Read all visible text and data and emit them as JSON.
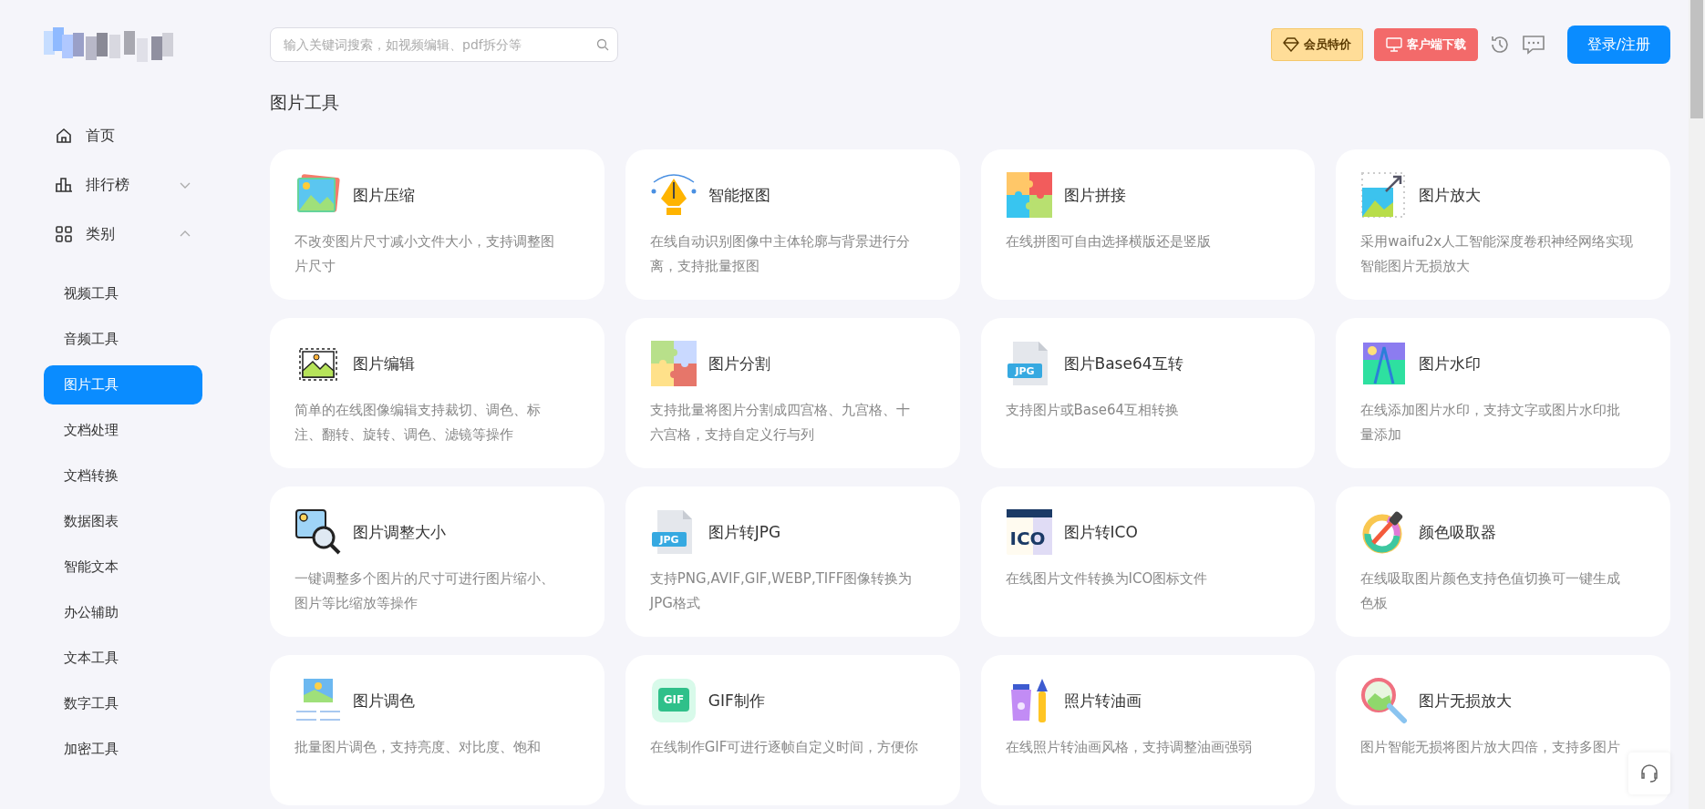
{
  "header": {
    "search": {
      "placeholder": "输入关键词搜索，如视频编辑、pdf拆分等"
    },
    "vip_button": "会员特价",
    "download_button": "客户端下载",
    "login_button": "登录/注册"
  },
  "sidebar": {
    "items": [
      {
        "label": "首页",
        "kind": "link"
      },
      {
        "label": "排行榜",
        "kind": "group",
        "expanded": false
      },
      {
        "label": "类别",
        "kind": "group",
        "expanded": true,
        "children": [
          {
            "label": "视频工具",
            "selected": false
          },
          {
            "label": "音频工具",
            "selected": false
          },
          {
            "label": "图片工具",
            "selected": true
          },
          {
            "label": "文档处理",
            "selected": false
          },
          {
            "label": "文档转换",
            "selected": false
          },
          {
            "label": "数据图表",
            "selected": false
          },
          {
            "label": "智能文本",
            "selected": false
          },
          {
            "label": "办公辅助",
            "selected": false
          },
          {
            "label": "文本工具",
            "selected": false
          },
          {
            "label": "数字工具",
            "selected": false
          },
          {
            "label": "加密工具",
            "selected": false
          }
        ]
      }
    ]
  },
  "section_title": "图片工具",
  "tools": [
    {
      "title": "图片压缩",
      "description": "不改变图片尺寸减小文件大小，支持调整图片尺寸"
    },
    {
      "title": "智能抠图",
      "description": "在线自动识别图像中主体轮廓与背景进行分离，支持批量抠图"
    },
    {
      "title": "图片拼接",
      "description": "在线拼图可自由选择横版还是竖版"
    },
    {
      "title": "图片放大",
      "description": "采用waifu2x人工智能深度卷积神经网络实现智能图片无损放大"
    },
    {
      "title": "图片编辑",
      "description": "简单的在线图像编辑支持裁切、调色、标注、翻转、旋转、调色、滤镜等操作"
    },
    {
      "title": "图片分割",
      "description": "支持批量将图片分割成四宫格、九宫格、十六宫格，支持自定义行与列"
    },
    {
      "title": "图片Base64互转",
      "description": "支持图片或Base64互相转换",
      "icon_label": "JPG"
    },
    {
      "title": "图片水印",
      "description": "在线添加图片水印，支持文字或图片水印批量添加"
    },
    {
      "title": "图片调整大小",
      "description": "一键调整多个图片的尺寸可进行图片缩小、图片等比缩放等操作"
    },
    {
      "title": "图片转JPG",
      "description": "支持PNG,AVIF,GIF,WEBP,TIFF图像转换为JPG格式",
      "icon_label": "JPG"
    },
    {
      "title": "图片转ICO",
      "description": "在线图片文件转换为ICO图标文件",
      "icon_label": "ICO"
    },
    {
      "title": "颜色吸取器",
      "description": "在线吸取图片颜色支持色值切换可一键生成色板"
    },
    {
      "title": "图片调色",
      "description": "批量图片调色，支持亮度、对比度、饱和"
    },
    {
      "title": "GIF制作",
      "description": "在线制作GIF可进行逐帧自定义时间，方便你",
      "icon_label": "GIF"
    },
    {
      "title": "照片转油画",
      "description": "在线照片转油画风格，支持调整油画强弱"
    },
    {
      "title": "图片无损放大",
      "description": "图片智能无损将图片放大四倍，支持多图片"
    }
  ]
}
